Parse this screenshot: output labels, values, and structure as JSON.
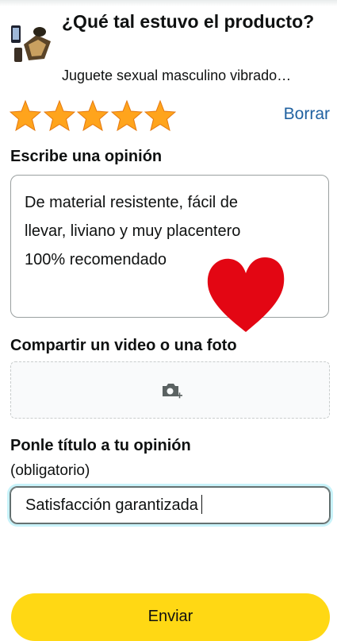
{
  "header": {
    "title": "¿Qué tal estuvo el producto?",
    "product_name": "Juguete sexual masculino vibrado…"
  },
  "rating": {
    "stars_filled": 5,
    "stars_total": 5,
    "star_color": "#ffa41c",
    "clear_label": "Borrar",
    "link_color": "#2162a1"
  },
  "review": {
    "section_label": "Escribe una opinión",
    "text": "De material resistente,  fácil de\nllevar, liviano y muy placentero\n100% recomendado",
    "drawing_icon": "heart-icon",
    "drawing_color": "#e30613"
  },
  "media": {
    "section_label": "Compartir un video o una foto",
    "icon": "camera-add-icon"
  },
  "review_title": {
    "section_label": "Ponle título a tu opinión",
    "required_note": "(obligatorio)",
    "value": "Satisfacción garantizada"
  },
  "submit": {
    "label": "Enviar",
    "color": "#ffd814"
  }
}
